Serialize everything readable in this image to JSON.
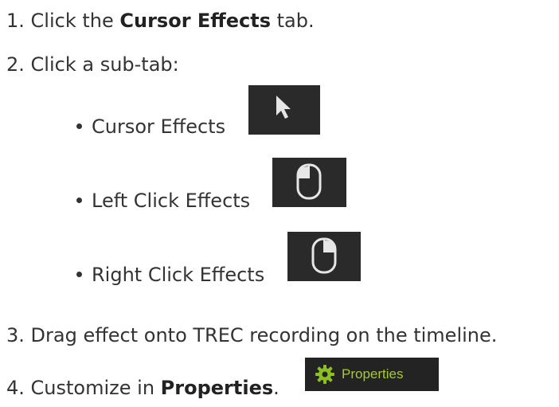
{
  "steps": [
    {
      "number": "1.",
      "text_before": "Click the ",
      "bold": "Cursor Effects",
      "text_after": " tab."
    },
    {
      "number": "2.",
      "text": "Click a sub-tab:"
    },
    {
      "number": "3.",
      "text": "Drag effect onto TREC recording on the timeline."
    },
    {
      "number": "4.",
      "text_before": "Customize in ",
      "bold": "Properties",
      "text_after": "."
    }
  ],
  "subtabs": [
    {
      "label": "Cursor Effects",
      "icon": "cursor-arrow-icon"
    },
    {
      "label": "Left Click Effects",
      "icon": "mouse-left-click-icon"
    },
    {
      "label": "Right Click Effects",
      "icon": "mouse-right-click-icon"
    }
  ],
  "properties_button": {
    "label": "Properties",
    "icon": "gear-icon"
  },
  "colors": {
    "text": "#333333",
    "icon_background": "#2a2a2a",
    "properties_label": "#a8c838",
    "gear": "#8cbf26"
  }
}
